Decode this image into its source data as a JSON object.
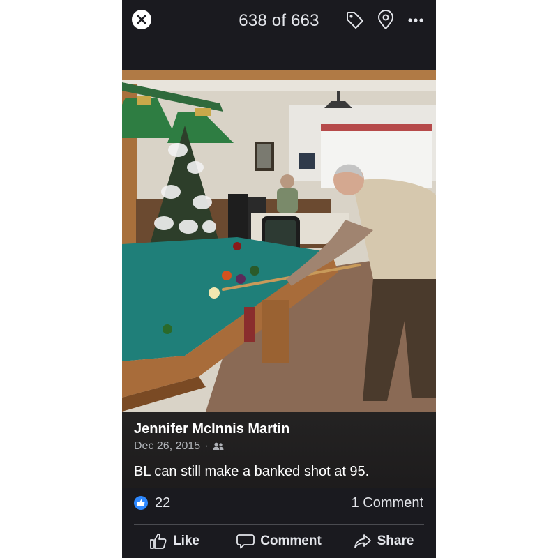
{
  "viewer": {
    "counter": "638 of 663"
  },
  "icons": {
    "close": "close-icon",
    "tag": "tag-icon",
    "location": "location-pin-icon",
    "more": "more-dots-icon",
    "audience": "friends-icon",
    "like_badge": "thumbs-up-icon"
  },
  "post": {
    "author": "Jennifer McInnis Martin",
    "date": "Dec 26, 2015",
    "separator": "·",
    "caption": "BL can still make a banked shot at 95."
  },
  "stats": {
    "likes": "22",
    "comments": "1 Comment"
  },
  "actions": {
    "like": "Like",
    "comment": "Comment",
    "share": "Share"
  },
  "colors": {
    "background": "#1a1a1f",
    "text": "#e4e6eb",
    "secondary_text": "#b0b3b8",
    "like_blue": "#2d88ff"
  }
}
